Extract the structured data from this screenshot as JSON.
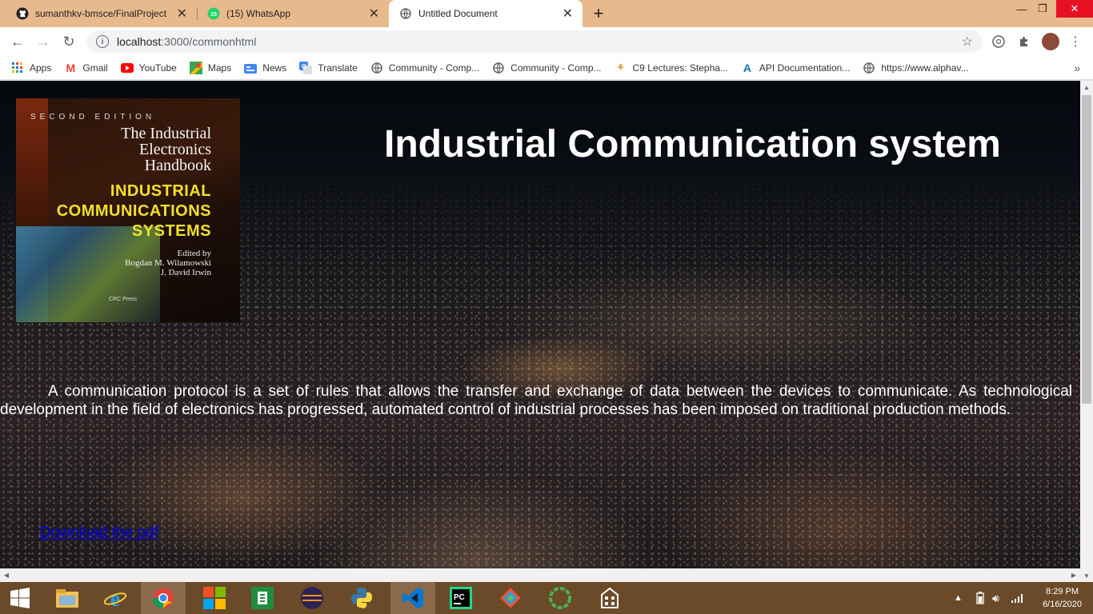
{
  "browser": {
    "tabs": [
      {
        "title": "sumanthkv-bmsce/FinalProject",
        "icon": "github-icon",
        "active": false
      },
      {
        "title": "(15) WhatsApp",
        "icon": "whatsapp-icon",
        "active": false,
        "badge": "15"
      },
      {
        "title": "Untitled Document",
        "icon": "globe-icon",
        "active": true
      }
    ],
    "url_host": "localhost",
    "url_path": ":3000/commonhtml",
    "bookmarks": [
      {
        "label": "Apps",
        "icon": "apps-grid-icon"
      },
      {
        "label": "Gmail",
        "icon": "gmail-icon"
      },
      {
        "label": "YouTube",
        "icon": "youtube-icon"
      },
      {
        "label": "Maps",
        "icon": "maps-icon"
      },
      {
        "label": "News",
        "icon": "news-icon"
      },
      {
        "label": "Translate",
        "icon": "translate-icon"
      },
      {
        "label": "Community - Comp...",
        "icon": "globe-icon"
      },
      {
        "label": "Community - Comp...",
        "icon": "globe-icon"
      },
      {
        "label": "C9 Lectures: Stepha...",
        "icon": "c9-icon"
      },
      {
        "label": "API Documentation...",
        "icon": "api-icon"
      },
      {
        "label": "https://www.alphav...",
        "icon": "globe-icon"
      }
    ]
  },
  "page": {
    "heading": "Industrial Communication system",
    "paragraph": "A communication protocol is a set of rules that allows the transfer and exchange of data between the devices to communicate. As technological development in the field of electronics has progressed, automated control of industrial processes has been imposed on traditional production methods.",
    "download_link": "Download the pdf",
    "book_cover": {
      "edition": "SECOND EDITION",
      "title_lines": [
        "The Industrial",
        "Electronics",
        "Handbook"
      ],
      "subtitle_lines": [
        "INDUSTRIAL",
        "COMMUNICATIONS",
        "SYSTEMS"
      ],
      "edited_by": "Edited by",
      "editors": [
        "Bogdan M. Wilamowski",
        "J. David Irwin"
      ],
      "publisher": "CRC Press"
    }
  },
  "taskbar": {
    "apps": [
      "windows-start-icon",
      "file-explorer-icon",
      "internet-explorer-icon",
      "chrome-icon",
      "office-icon",
      "excel-icon",
      "eclipse-icon",
      "python-icon",
      "vscode-icon",
      "pycharm-icon",
      "git-icon",
      "circle-app-icon",
      "building-app-icon"
    ],
    "time": "8:29 PM",
    "date": "6/16/2020"
  },
  "colors": {
    "tabstrip": "#e8b98c",
    "link": "#0000ee",
    "book_subtitle": "#f2e027"
  }
}
